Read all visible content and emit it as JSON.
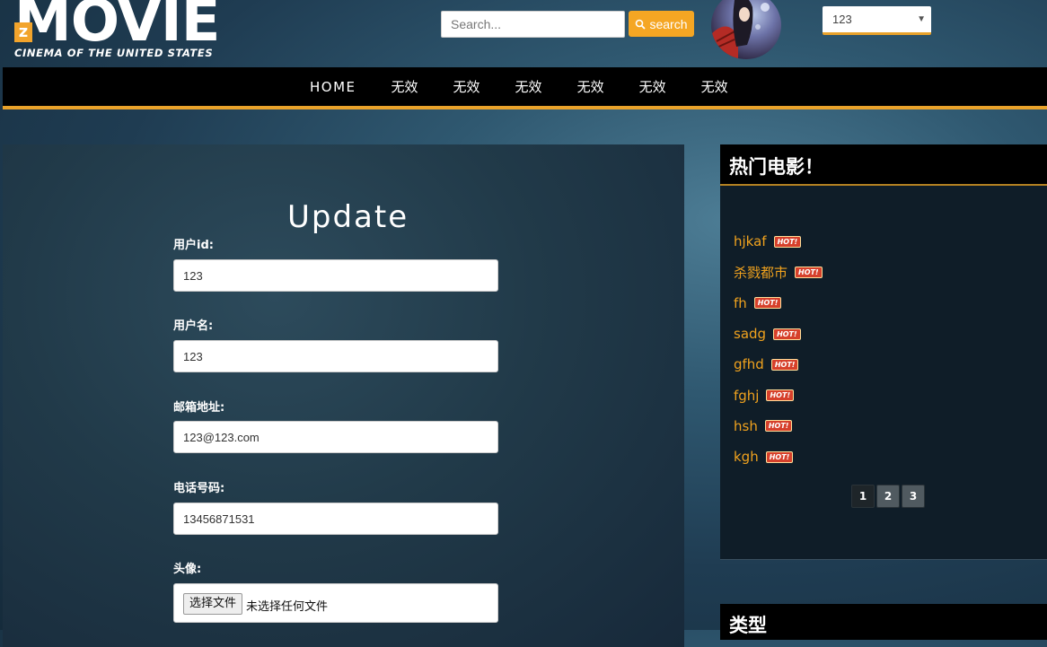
{
  "header": {
    "logo_text": "MOVIE",
    "logo_z": "z",
    "logo_tagline": "CINEMA OF THE UNITED STATES",
    "search_placeholder": "Search...",
    "search_button": "search",
    "user_select": "123"
  },
  "nav": {
    "items": [
      "HOME",
      "无效",
      "无效",
      "无效",
      "无效",
      "无效",
      "无效"
    ]
  },
  "form": {
    "title": "Update",
    "fields": [
      {
        "label": "用户id:",
        "value": "123"
      },
      {
        "label": "用户名:",
        "value": "123"
      },
      {
        "label": "邮箱地址:",
        "value": "123@123.com"
      },
      {
        "label": "电话号码:",
        "value": "13456871531"
      }
    ],
    "avatar_label": "头像:",
    "file_button": "选择文件",
    "file_status": "未选择任何文件"
  },
  "sidebar": {
    "title": "热门电影！",
    "hot_badge": "HOT!",
    "movies": [
      "hjkaf",
      "杀戮都市",
      "fh",
      "sadg",
      "gfhd",
      "fghj",
      "hsh",
      "kgh"
    ],
    "pages": [
      "1",
      "2",
      "3"
    ],
    "active_page": "1"
  },
  "types": {
    "title": "类型"
  },
  "colors": {
    "accent": "#f5a623",
    "link": "#f0a21e",
    "badge": "#d6402b"
  }
}
